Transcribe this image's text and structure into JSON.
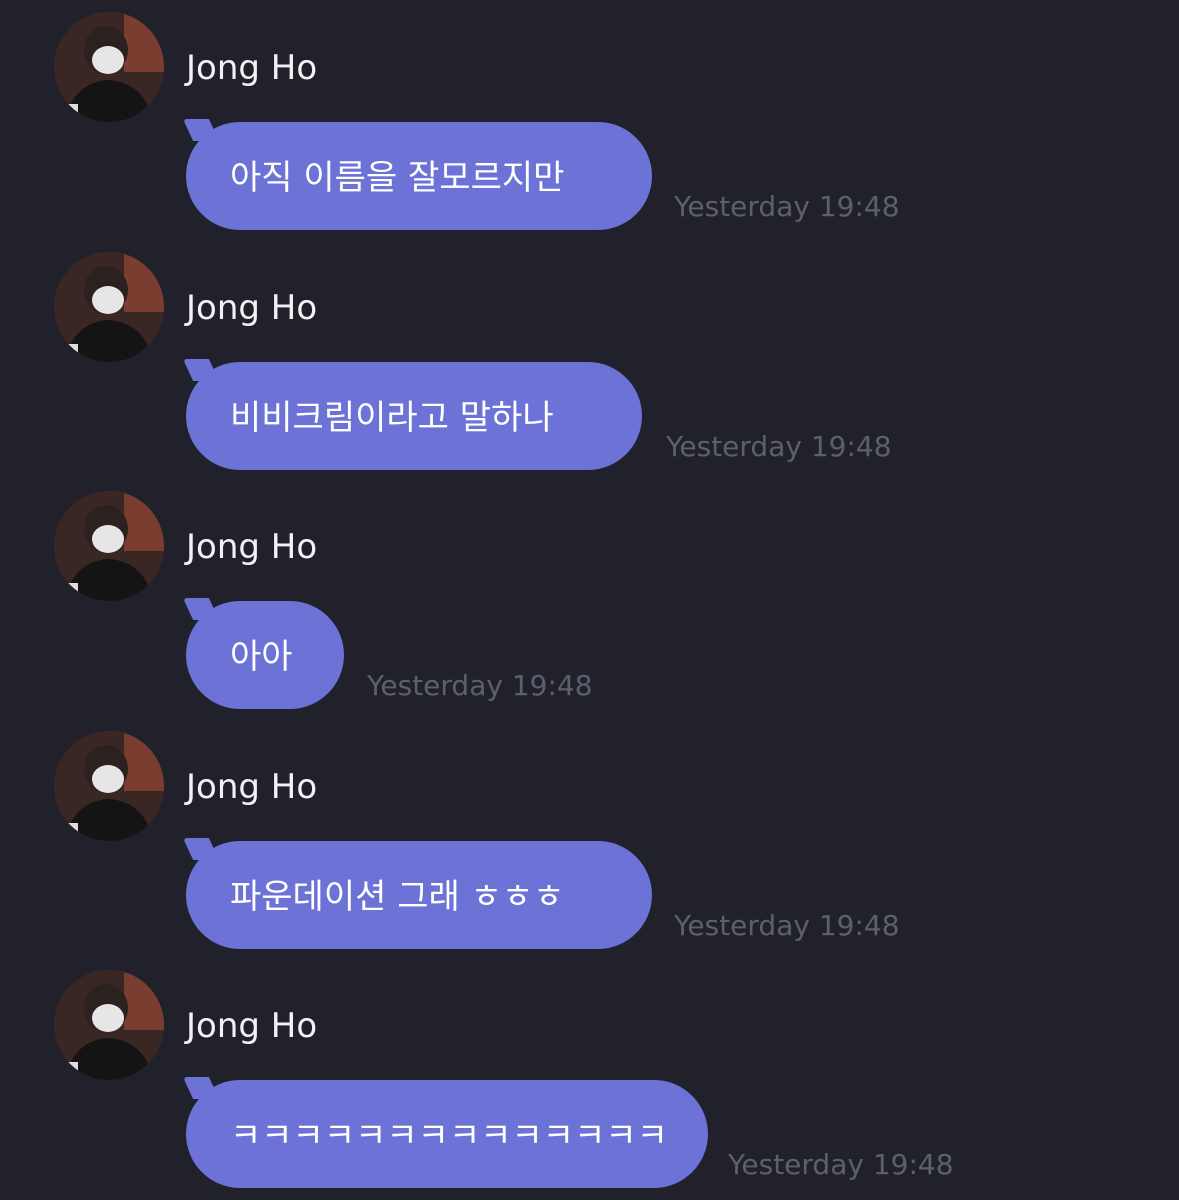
{
  "messages": [
    {
      "sender": "Jong Ho",
      "text": "아직 이름을 잘모르지만",
      "time": "Yesterday 19:48"
    },
    {
      "sender": "Jong Ho",
      "text": "비비크림이라고 말하나",
      "time": "Yesterday 19:48"
    },
    {
      "sender": "Jong Ho",
      "text": "아아",
      "time": "Yesterday 19:48"
    },
    {
      "sender": "Jong Ho",
      "text": "파운데이션 그래 ㅎㅎㅎ",
      "time": "Yesterday 19:48"
    },
    {
      "sender": "Jong Ho",
      "text": "ㅋㅋㅋㅋㅋㅋㅋㅋㅋㅋㅋㅋㅋㅋ",
      "time": "Yesterday 19:48"
    }
  ],
  "colors": {
    "background": "#21212b",
    "bubble": "#6c72d6",
    "name": "#f2f2f5",
    "timestamp": "#5e5f6c"
  },
  "icons": {
    "avatar": "profile-photo-avatar"
  }
}
